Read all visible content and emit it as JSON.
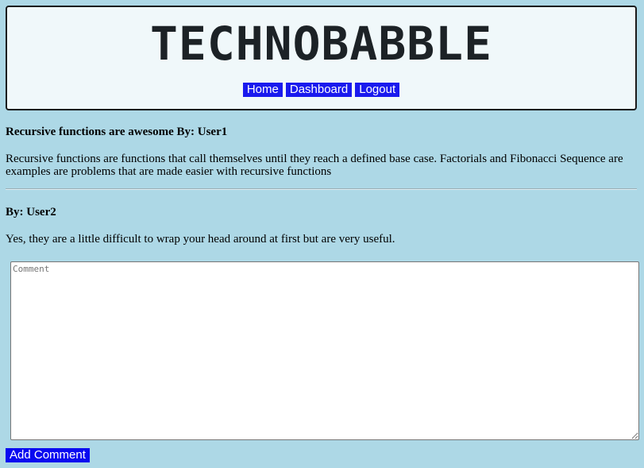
{
  "header": {
    "logo_text": "TECHNOBABBLE",
    "nav": [
      {
        "label": "Home"
      },
      {
        "label": "Dashboard"
      },
      {
        "label": "Logout"
      }
    ]
  },
  "post": {
    "title": "Recursive functions are awesome By: User1",
    "body": "Recursive functions are functions that call themselves until they reach a defined base case. Factorials and Fibonacci Sequence are examples are problems that are made easier with recursive functions"
  },
  "comments": [
    {
      "author": "By: User2",
      "text": "Yes, they are a little difficult to wrap your head around at first but are very useful."
    }
  ],
  "comment_form": {
    "value": "",
    "placeholder": "Comment",
    "submit_label": "Add Comment"
  },
  "colors": {
    "page_background": "#add8e6",
    "header_background": "#f0f8fa",
    "nav_button": "#1a1aee",
    "submit_button": "#0a0af0"
  }
}
